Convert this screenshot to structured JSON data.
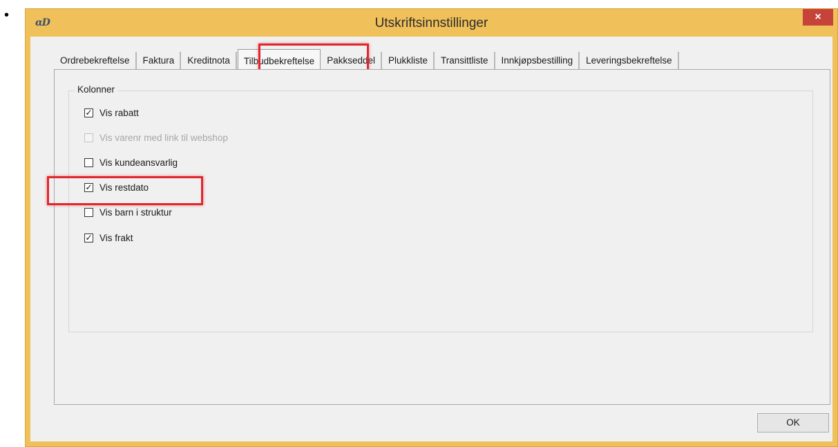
{
  "bullet": "•",
  "window": {
    "title": "Utskriftsinnstillinger",
    "app_icon_text": "ɑD",
    "close_label": "×"
  },
  "tabs": [
    {
      "label": "Ordrebekreftelse",
      "active": false
    },
    {
      "label": "Faktura",
      "active": false
    },
    {
      "label": "Kreditnota",
      "active": false
    },
    {
      "label": "Tilbudbekreftelse",
      "active": true
    },
    {
      "label": "Pakkseddel",
      "active": false
    },
    {
      "label": "Plukkliste",
      "active": false
    },
    {
      "label": "Transittliste",
      "active": false
    },
    {
      "label": "Innkjøpsbestilling",
      "active": false
    },
    {
      "label": "Leveringsbekreftelse",
      "active": false
    }
  ],
  "group": {
    "legend": "Kolonner",
    "checkboxes": [
      {
        "label": "Vis rabatt",
        "checked": true,
        "enabled": true,
        "mark": "✓"
      },
      {
        "label": "Vis varenr med link til webshop",
        "checked": false,
        "enabled": false,
        "mark": ""
      },
      {
        "label": "Vis kundeansvarlig",
        "checked": false,
        "enabled": true,
        "mark": ""
      },
      {
        "label": "Vis restdato",
        "checked": true,
        "enabled": true,
        "mark": "✓"
      },
      {
        "label": "Vis barn i struktur",
        "checked": false,
        "enabled": true,
        "mark": ""
      },
      {
        "label": "Vis frakt",
        "checked": true,
        "enabled": true,
        "mark": "✓"
      }
    ]
  },
  "ok_label": "OK",
  "colors": {
    "title_bar": "#f0c05a",
    "close_button": "#c6433a",
    "highlight": "#e0262e",
    "client_bg": "#f0f0f0"
  }
}
